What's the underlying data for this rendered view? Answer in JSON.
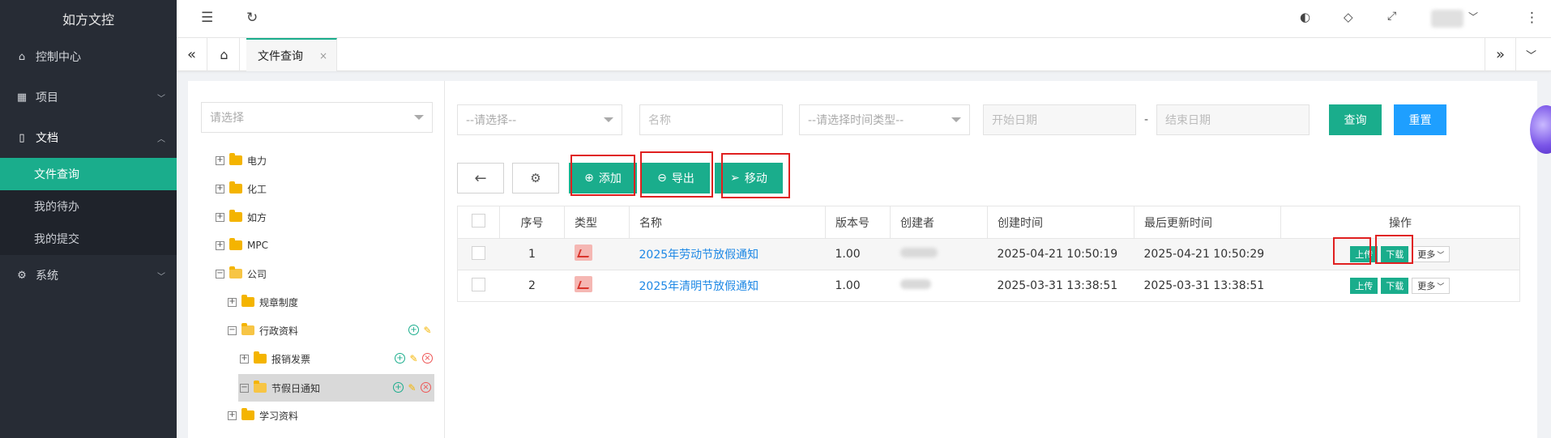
{
  "brand": "如方文控",
  "sidebar": {
    "items": [
      {
        "label": "控制中心",
        "icon": "home-icon"
      },
      {
        "label": "项目",
        "icon": "grid-icon"
      },
      {
        "label": "文档",
        "icon": "document-icon"
      },
      {
        "label": "系统",
        "icon": "gear-icon"
      }
    ],
    "sub": [
      {
        "label": "文件查询"
      },
      {
        "label": "我的待办"
      },
      {
        "label": "我的提交"
      }
    ]
  },
  "tabs": {
    "active": "文件查询",
    "close": "×"
  },
  "tree": {
    "placeholder": "请选择",
    "nodes": [
      {
        "label": "电力"
      },
      {
        "label": "化工"
      },
      {
        "label": "如方"
      },
      {
        "label": "MPC"
      },
      {
        "label": "公司"
      },
      {
        "label": "规章制度"
      },
      {
        "label": "行政资料"
      },
      {
        "label": "报销发票"
      },
      {
        "label": "节假日通知"
      },
      {
        "label": "学习资料"
      }
    ]
  },
  "filters": {
    "select1": "--请选择--",
    "name": "名称",
    "timeType": "--请选择时间类型--",
    "start": "开始日期",
    "dash": "-",
    "end": "结束日期",
    "query": "查询",
    "reset": "重置"
  },
  "toolbar": {
    "back": "←",
    "settings": "⚙",
    "add": "添加",
    "export": "导出",
    "move": "移动"
  },
  "table": {
    "headers": [
      "序号",
      "类型",
      "名称",
      "版本号",
      "创建者",
      "创建时间",
      "最后更新时间",
      "操作"
    ],
    "rows": [
      {
        "no": "1",
        "name": "2025年劳动节放假通知",
        "version": "1.00",
        "created": "2025-04-21 10:50:19",
        "updated": "2025-04-21 10:50:29"
      },
      {
        "no": "2",
        "name": "2025年清明节放假通知",
        "version": "1.00",
        "created": "2025-03-31 13:38:51",
        "updated": "2025-03-31 13:38:51"
      }
    ],
    "actions": {
      "upload": "上传",
      "download": "下载",
      "more": "更多"
    }
  },
  "colors": {
    "primary": "#1aad8c",
    "blue": "#1e9fff",
    "sidebar": "#272c35",
    "highlight": "#e02020"
  }
}
